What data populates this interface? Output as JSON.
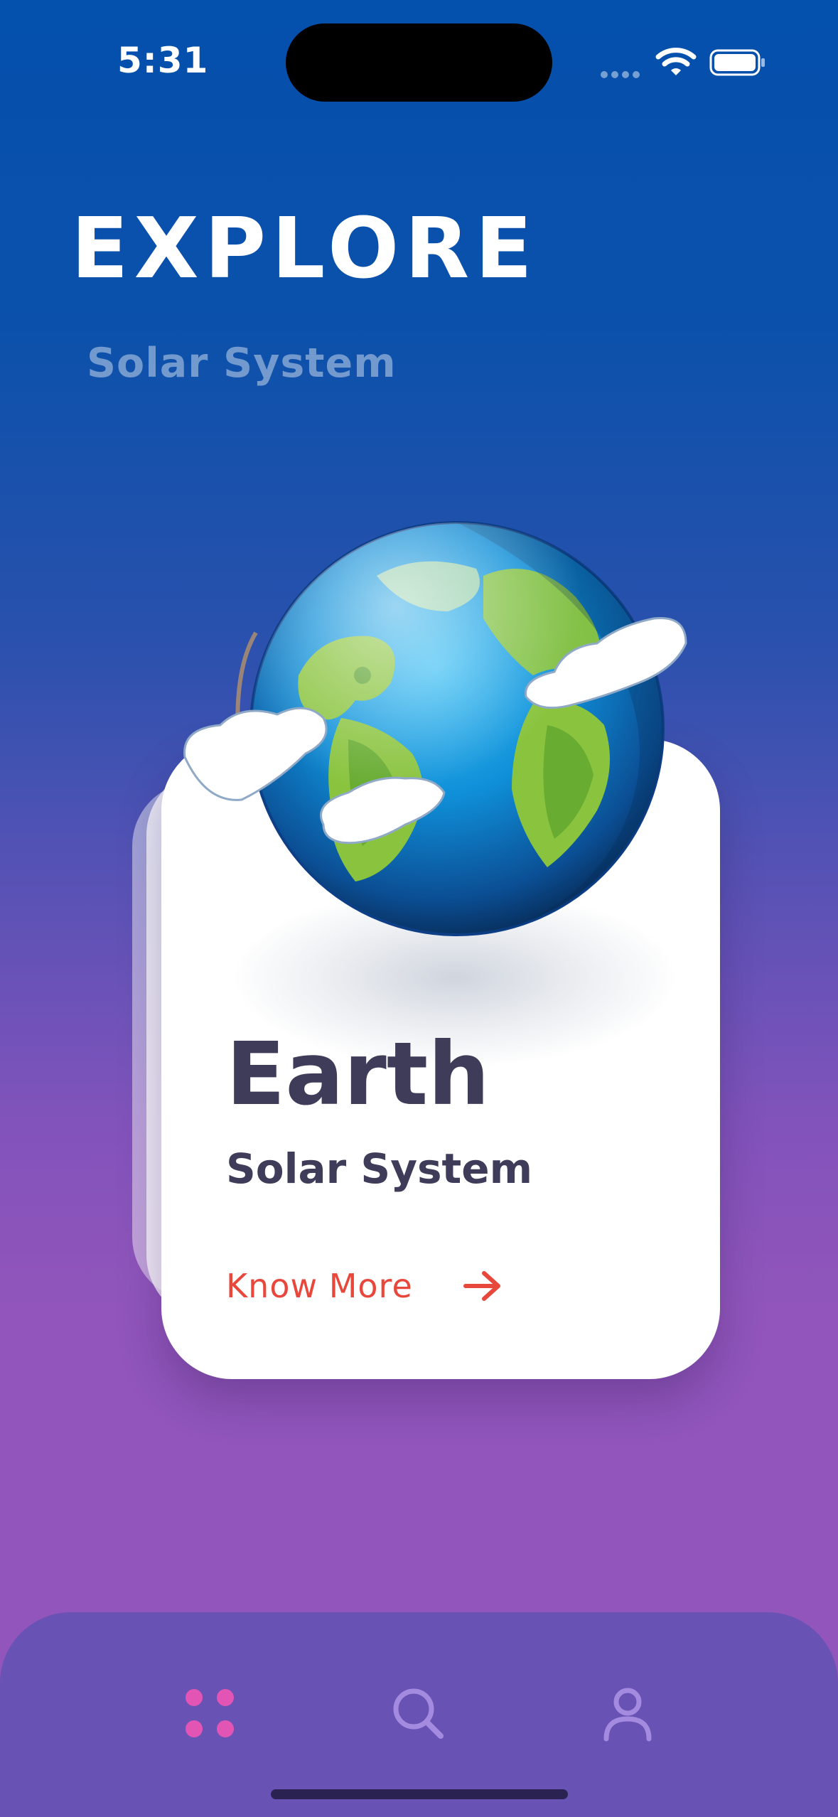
{
  "status_bar": {
    "time": "5:31",
    "icons": [
      "cellular-signal-icon",
      "wifi-icon",
      "battery-icon"
    ]
  },
  "header": {
    "title": "EXPLORE",
    "subtitle": "Solar System"
  },
  "planet_card": {
    "name": "Earth",
    "system": "Solar System",
    "action_label": "Know More",
    "action_icon": "arrow-right-icon",
    "image": "earth-illustration"
  },
  "bottom_nav": {
    "items": [
      {
        "icon": "grid-dots-icon",
        "active": true
      },
      {
        "icon": "search-icon",
        "active": false
      },
      {
        "icon": "profile-icon",
        "active": false
      }
    ]
  },
  "colors": {
    "gradient_top": "#0450ad",
    "gradient_bottom": "#9155bb",
    "card_text": "#3f3c5a",
    "accent_red": "#e8473c",
    "nav_background": "#6852b4",
    "nav_active": "#e255b5",
    "nav_inactive": "#a58be0"
  }
}
